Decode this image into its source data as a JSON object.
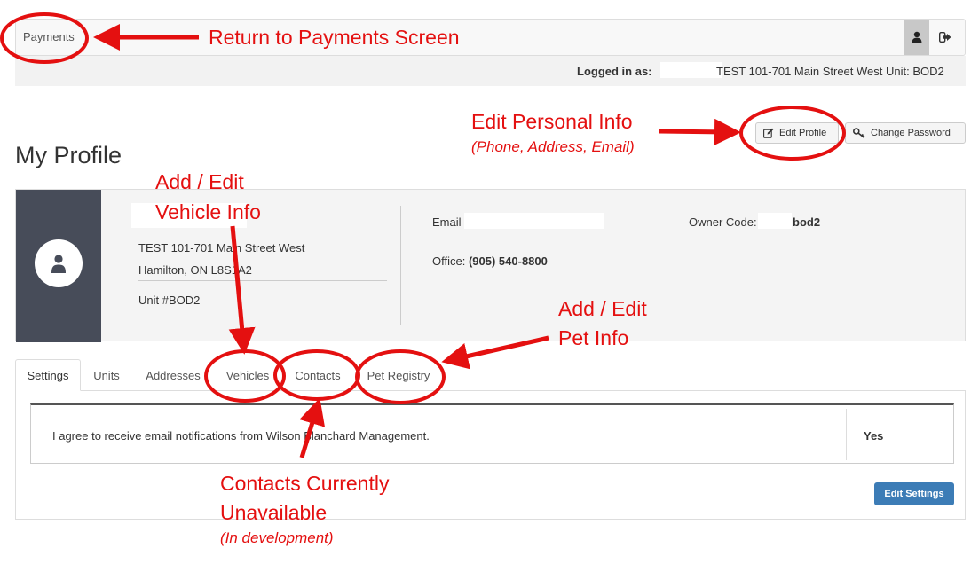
{
  "nav": {
    "payments_label": "Payments",
    "user_icon": "user-icon",
    "logout_icon": "logout-icon"
  },
  "logged_in": {
    "label": "Logged in as:",
    "user": "TEST 101-701 Main Street West Unit: BOD2"
  },
  "actions": {
    "edit_profile": "Edit Profile",
    "change_password": "Change Password"
  },
  "page": {
    "title": "My Profile"
  },
  "profile": {
    "address_line1": "TEST 101-701 Main Street West",
    "address_line2": "Hamilton, ON L8S1A2",
    "unit": "Unit #BOD2",
    "email_label": "Email",
    "owner_code_label": "Owner Code:",
    "owner_code": "bod2",
    "office_label": "Office:",
    "office_phone": "(905) 540-8800"
  },
  "tabs": [
    {
      "label": "Settings",
      "active": true
    },
    {
      "label": "Units"
    },
    {
      "label": "Addresses"
    },
    {
      "label": "Vehicles"
    },
    {
      "label": "Contacts"
    },
    {
      "label": "Pet Registry"
    }
  ],
  "settings": {
    "notification_text": "I agree to receive email notifications from Wilson Blanchard Management.",
    "notification_value": "Yes",
    "edit_button": "Edit Settings"
  },
  "annotations": {
    "return_payments": "Return to Payments Screen",
    "edit_personal": "Edit Personal Info",
    "edit_personal_sub": "(Phone, Address, Email)",
    "vehicle_line1": "Add / Edit",
    "vehicle_line2": "Vehicle Info",
    "pet_line1": "Add / Edit",
    "pet_line2": "Pet Info",
    "contacts_line1": "Contacts Currently",
    "contacts_line2": "Unavailable",
    "contacts_sub": "(In development)"
  },
  "colors": {
    "annotation_red": "#e41010",
    "avatar_panel": "#474c59",
    "primary_button": "#3c7cb6"
  }
}
